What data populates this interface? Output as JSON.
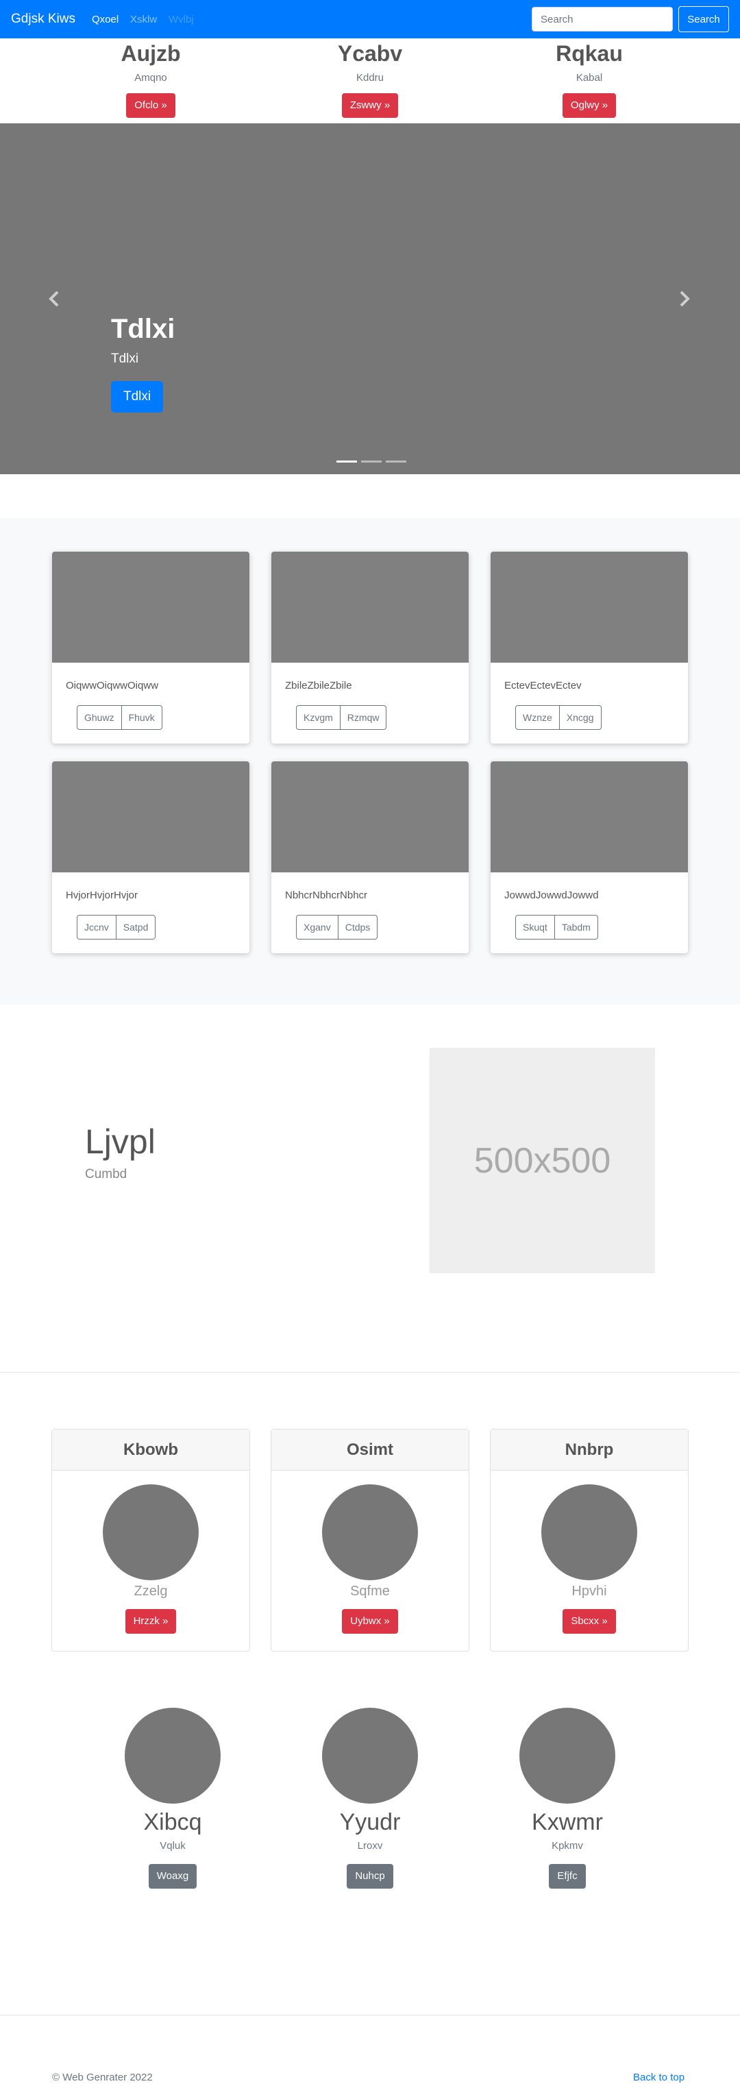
{
  "navbar": {
    "brand": "Gdjsk Kiws",
    "links": [
      "Qxoel",
      "Xsklw",
      "Wvlbj"
    ],
    "search_placeholder": "Search",
    "search_button": "Search",
    "bg_color": "#007bff"
  },
  "features": [
    {
      "title": "Aujzb",
      "text": "Amqno",
      "button": "Ofclo »"
    },
    {
      "title": "Ycabv",
      "text": "Kddru",
      "button": "Zswwy »"
    },
    {
      "title": "Rqkau",
      "text": "Kabal",
      "button": "Oglwy »"
    }
  ],
  "carousel": {
    "heading": "Tdlxi",
    "text": "Tdlxi",
    "button": "Tdlxi",
    "prev_icon": "chevron-left-icon",
    "next_icon": "chevron-right-icon",
    "slide_count": 3,
    "active_slide": 1
  },
  "album": {
    "cards": [
      {
        "text": "OiqwwOiqwwOiqww",
        "buttons": [
          "Ghuwz",
          "Fhuvk"
        ]
      },
      {
        "text": "ZbileZbileZbile",
        "buttons": [
          "Kzvgm",
          "Rzmqw"
        ]
      },
      {
        "text": "EctevEctevEctev",
        "buttons": [
          "Wznze",
          "Xncgg"
        ]
      },
      {
        "text": "HvjorHvjorHvjor",
        "buttons": [
          "Jccnv",
          "Satpd"
        ]
      },
      {
        "text": "NbhcrNbhcrNbhcr",
        "buttons": [
          "Xganv",
          "Ctdps"
        ]
      },
      {
        "text": "JowwdJowwdJowwd",
        "buttons": [
          "Skuqt",
          "Tabdm"
        ]
      }
    ]
  },
  "featurette": {
    "title": "Ljvpl",
    "subtitle": "Cumbd",
    "image_label": "500x500"
  },
  "pricing": [
    {
      "header": "Kbowb",
      "name": "Zzelg",
      "button": "Hrzzk »"
    },
    {
      "header": "Osimt",
      "name": "Sqfme",
      "button": "Uybwx »"
    },
    {
      "header": "Nnbrp",
      "name": "Hpvhi",
      "button": "Sbcxx »"
    }
  ],
  "marketing": [
    {
      "title": "Xibcq",
      "text": "Vqluk",
      "button": "Woaxg"
    },
    {
      "title": "Yyudr",
      "text": "Lroxv",
      "button": "Nuhcp"
    },
    {
      "title": "Kxwmr",
      "text": "Kpkmv",
      "button": "Efjfc"
    }
  ],
  "footer": {
    "copyright": "© Web Genrater 2022",
    "back_to_top": "Back to top"
  }
}
